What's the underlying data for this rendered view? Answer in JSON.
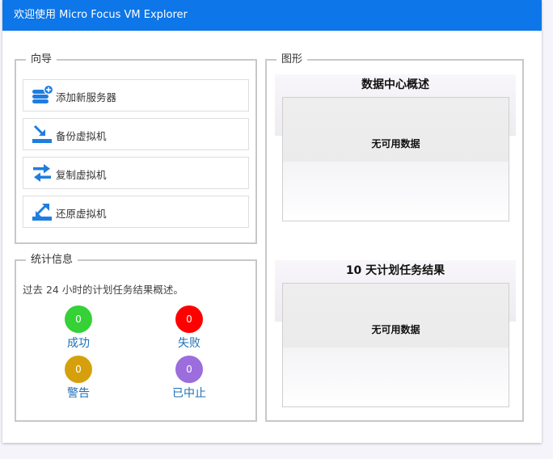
{
  "title": "欢迎使用 Micro Focus VM Explorer",
  "wizard": {
    "legend": "向导",
    "items": [
      {
        "label": "添加新服务器",
        "icon": "server-add-icon"
      },
      {
        "label": "备份虚拟机",
        "icon": "backup-icon"
      },
      {
        "label": "复制虚拟机",
        "icon": "replicate-icon"
      },
      {
        "label": "还原虚拟机",
        "icon": "restore-icon"
      }
    ]
  },
  "stats": {
    "legend": "统计信息",
    "description": "过去 24 小时的计划任务结果概述。",
    "items": [
      {
        "count": "0",
        "label": "成功",
        "color": "#35d136"
      },
      {
        "count": "0",
        "label": "失败",
        "color": "#ff0000"
      },
      {
        "count": "0",
        "label": "警告",
        "color": "#d6a00d"
      },
      {
        "count": "0",
        "label": "已中止",
        "color": "#9b6ddd"
      }
    ]
  },
  "graph": {
    "legend": "图形",
    "charts": [
      {
        "title": "数据中心概述",
        "no_data": "无可用数据"
      },
      {
        "title": "10 天计划任务结果",
        "no_data": "无可用数据"
      }
    ]
  },
  "colors": {
    "titlebar": "#0d76e8",
    "icon_blue": "#1e7de0",
    "link": "#1f6fb5"
  }
}
